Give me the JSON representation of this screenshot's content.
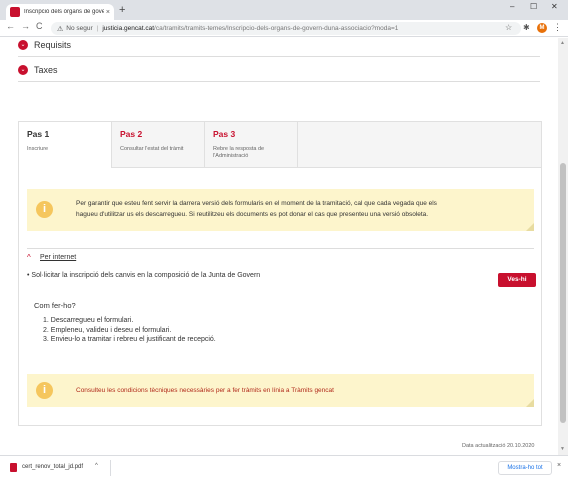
{
  "browser": {
    "tab_title": "Inscripció dels òrgans de govern",
    "tab_close": "×",
    "new_tab": "+",
    "window": {
      "minimize": "–",
      "maximize": "☐",
      "close": "✕"
    },
    "nav": {
      "back": "←",
      "forward": "→",
      "reload": "C"
    },
    "security_icon": "⚠",
    "not_secure": "No segur",
    "separator": "|",
    "url_host": "justicia.gencat.cat",
    "url_path": "/ca/tramits/tramits-temes/Inscripcio-dels-organs-de-govern-duna-associacio?moda=1",
    "star_icon": "☆",
    "extensions_icon": "✱",
    "avatar_letter": "M",
    "menu_icon": "⋮"
  },
  "accordions": [
    {
      "label": "Requisits",
      "icon": "⌄"
    },
    {
      "label": "Taxes",
      "icon": "⌄"
    }
  ],
  "steps": [
    {
      "title": "Pas 1",
      "desc": "Inscriure"
    },
    {
      "title": "Pas 2",
      "desc": "Consultar l'estat del tràmit"
    },
    {
      "title": "Pas 3",
      "desc": "Rebre la resposta de l'Administració"
    }
  ],
  "notice1": {
    "icon": "i",
    "text_line1": "Per garantir que esteu fent servir la darrera versió dels formularis en el moment de la tramitació, cal que cada vegada que els",
    "text_line2": "hagueu d'utilitzar us els descarregueu. Si reutilitzeu els documents es pot donar el cas que presenteu una versió obsoleta."
  },
  "internet": {
    "chevron": "^",
    "label": "Per internet",
    "bullet": "• Sol·licitar la inscripció dels canvis en la composició de la Junta de Govern",
    "button": "Ves-hi"
  },
  "howto": {
    "title": "Com fer-ho?",
    "items": [
      "1. Descarregueu el formulari.",
      "2. Empleneu, valideu i deseu el formulari.",
      "3. Envieu-lo a tramitar i rebreu el justificant de recepció."
    ]
  },
  "notice2": {
    "icon": "i",
    "text": "Consulteu les condicions tècniques necessàries per a fer tràmits en línia a Tràmits gencat"
  },
  "updated": "Data actualització 20.10.2020",
  "scroll": {
    "up": "▲",
    "down": "▼"
  },
  "download": {
    "filename": "cert_renov_total_jd.pdf",
    "chevron": "^",
    "show_all": "Mostra-ho tot",
    "close": "×"
  },
  "colors": {
    "accent": "#c8102e",
    "notice_bg": "#fdf5cc",
    "notice_icon": "#f5c65d"
  }
}
